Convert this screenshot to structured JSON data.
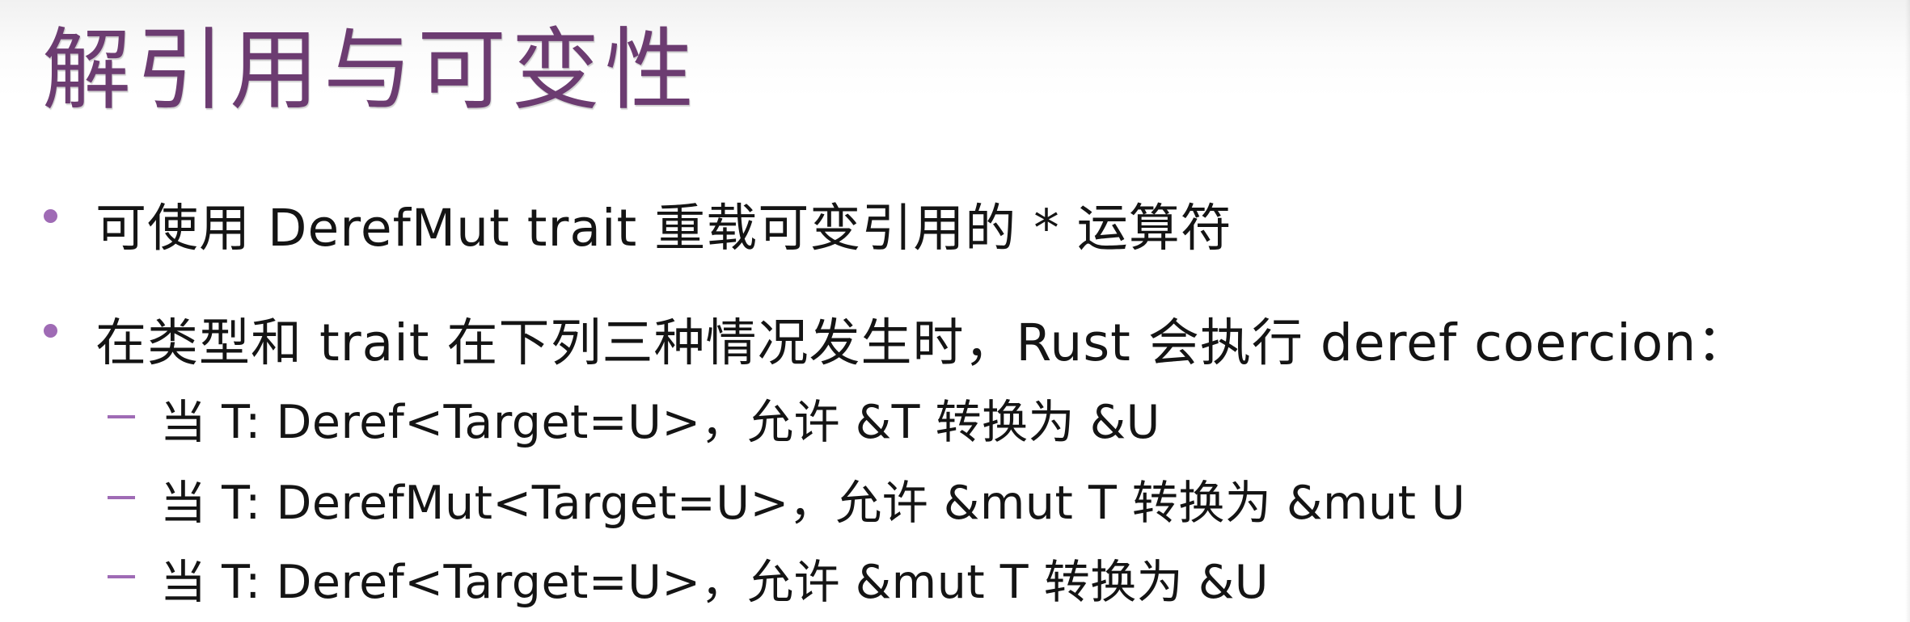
{
  "slide": {
    "title": "解引用与可变性",
    "bullets": [
      {
        "text": "可使用 DerefMut trait 重载可变引用的 * 运算符"
      },
      {
        "text": "在类型和 trait 在下列三种情况发生时，Rust 会执行 deref coercion："
      }
    ],
    "sub_bullets": [
      {
        "text": "当 T: Deref<Target=U>，允许 &T 转换为 &U"
      },
      {
        "text": "当 T: DerefMut<Target=U>，允许 &mut T 转换为 &mut U"
      },
      {
        "text": "当 T: Deref<Target=U>，允许 &mut T 转换为 &U"
      }
    ],
    "colors": {
      "title": "#6c3c71",
      "bullet_marker": "#9f6bb5",
      "body_text": "#141414"
    }
  }
}
